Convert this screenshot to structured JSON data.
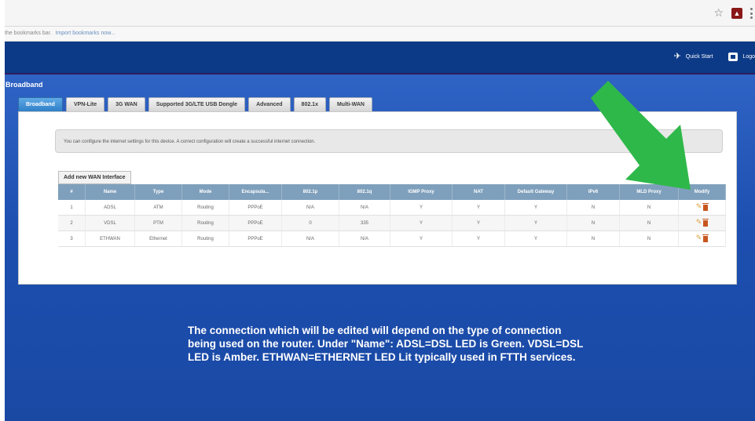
{
  "browser": {
    "bookmarks_text": "the bookmarks bar.",
    "bookmarks_link": "Import bookmarks now...",
    "icons": [
      "star-icon",
      "extension-icon",
      "menu-icon"
    ]
  },
  "header": {
    "quick_start": "Quick Start",
    "logout": "Logo"
  },
  "page": {
    "title": "Broadband",
    "tabs": [
      {
        "label": "Broadband",
        "active": true
      },
      {
        "label": "VPN-Lite",
        "active": false
      },
      {
        "label": "3G WAN",
        "active": false
      },
      {
        "label": "Supported 3G/LTE USB Dongle",
        "active": false
      },
      {
        "label": "Advanced",
        "active": false
      },
      {
        "label": "802.1x",
        "active": false
      },
      {
        "label": "Multi-WAN",
        "active": false
      }
    ],
    "info_text": "You can configure the internet settings for this device. A correct configuration will create a successful internet connection.",
    "add_button": "Add new WAN Interface"
  },
  "table": {
    "headers": [
      "#",
      "Name",
      "Type",
      "Mode",
      "Encapsula...",
      "802.1p",
      "802.1q",
      "IGMP Proxy",
      "NAT",
      "Default Gateway",
      "IPv6",
      "MLD Proxy",
      "Modify"
    ],
    "rows": [
      [
        "1",
        "ADSL",
        "ATM",
        "Routing",
        "PPPoE",
        "N/A",
        "N/A",
        "Y",
        "Y",
        "Y",
        "N",
        "N"
      ],
      [
        "2",
        "VDSL",
        "PTM",
        "Routing",
        "PPPoE",
        "0",
        "335",
        "Y",
        "Y",
        "Y",
        "N",
        "N"
      ],
      [
        "3",
        "ETHWAN",
        "Ethernet",
        "Routing",
        "PPPoE",
        "N/A",
        "N/A",
        "Y",
        "Y",
        "Y",
        "N",
        "N"
      ]
    ]
  },
  "caption": {
    "line1": "The connection which will be edited will depend on the type of connection",
    "line2": "being used on the router. Under \"Name\": ADSL=DSL LED is Green. VDSL=DSL",
    "line3": "LED is Amber. ETHWAN=ETHERNET LED Lit typically used in FTTH services."
  },
  "colors": {
    "header_blue": "#0d3a87",
    "page_blue": "#2f63c4",
    "table_header": "#7fa0bc",
    "arrow_green": "#2fb84a"
  }
}
